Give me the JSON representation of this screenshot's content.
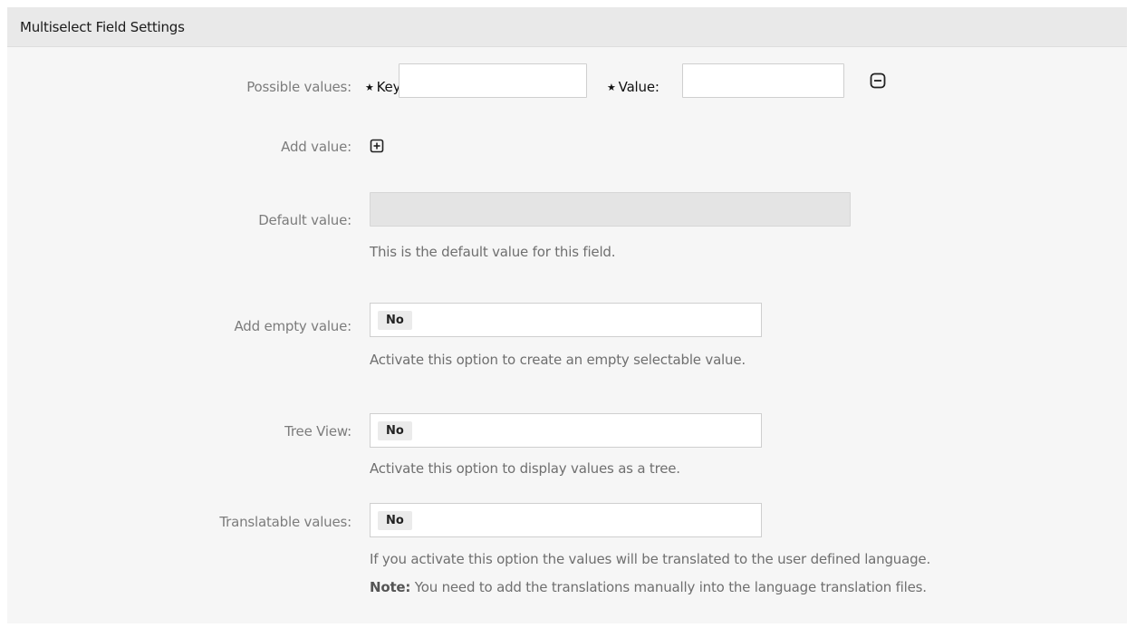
{
  "section": {
    "title": "Multiselect Field Settings"
  },
  "possible_values": {
    "label": "Possible values:",
    "key_label": "Key:",
    "value_label": "Value:",
    "required_marker": "★",
    "key_value": "",
    "value_value": ""
  },
  "add_value": {
    "label": "Add value:"
  },
  "default_value": {
    "label": "Default value:",
    "value": "",
    "help": "This is the default value for this field."
  },
  "add_empty_value": {
    "label": "Add empty value:",
    "selected": "No",
    "help": "Activate this option to create an empty selectable value."
  },
  "tree_view": {
    "label": "Tree View:",
    "selected": "No",
    "help": "Activate this option to display values as a tree."
  },
  "translatable_values": {
    "label": "Translatable values:",
    "selected": "No",
    "help": "If you activate this option the values will be translated to the user defined language.",
    "note_prefix": "Note:",
    "note_text": " You need to add the translations manually into the language translation files."
  },
  "icons": {
    "remove": "minus-square-icon",
    "add": "plus-square-icon"
  }
}
